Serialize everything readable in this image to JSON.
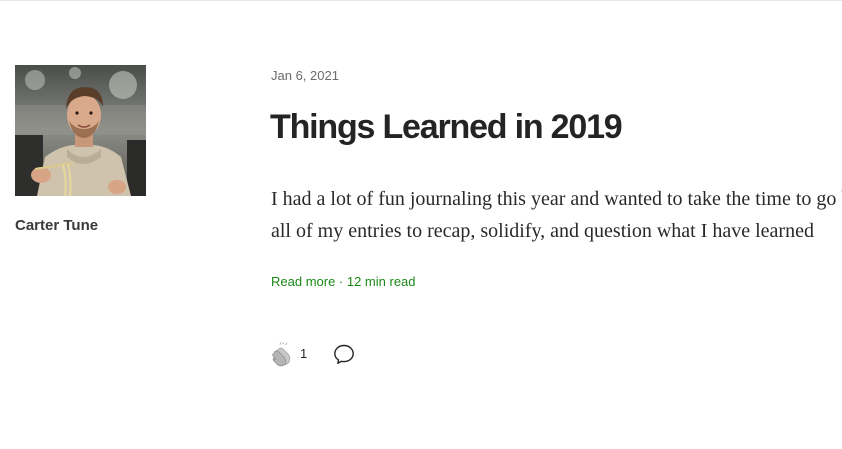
{
  "author": {
    "name": "Carter Tune"
  },
  "post": {
    "date": "Jan 6, 2021",
    "title": "Things Learned in 2019",
    "excerpt_lines": [
      "I had a lot of fun journaling this year and wanted to take the time to go back through",
      "all of my entries to recap, solidify, and question what I have learned"
    ],
    "read_more": "Read more · 12 min read"
  },
  "actions": {
    "clap_count": "1",
    "clap_icon": "clap-icon",
    "response_icon": "speech-bubble-icon"
  },
  "colors": {
    "accent_green": "#1a8917",
    "title": "#242424",
    "meta_gray": "#6b6b6b"
  }
}
